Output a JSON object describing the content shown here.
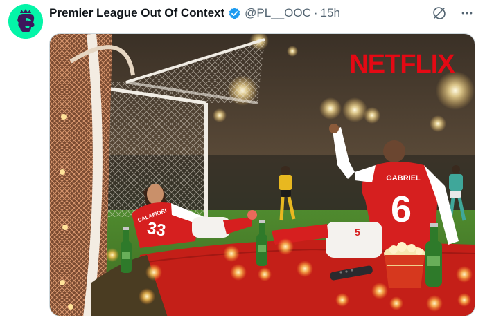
{
  "tweet": {
    "author_name": "Premier League Out Of Context",
    "handle": "@PL__OOC",
    "separator": "·",
    "time": "15h",
    "verified": true,
    "icons": {
      "avatar": "premier-league-lion-icon",
      "verified": "verified-badge-icon",
      "grok": "grok-icon",
      "more": "more-horizontal-icon"
    }
  },
  "image": {
    "overlay_logo": "NETFLIX",
    "player_back_name": "GABRIEL",
    "player_back_number": "6",
    "player_left_name": "CALAFIORI",
    "player_left_number": "33",
    "player_left_shorts_number": "5"
  },
  "colors": {
    "avatar_bg": "#04f5a8",
    "verified": "#1d9bf0",
    "netflix": "#e50914",
    "kit_red": "#d61f1f",
    "blanket": "#c41f18",
    "muted_text": "#536471"
  }
}
